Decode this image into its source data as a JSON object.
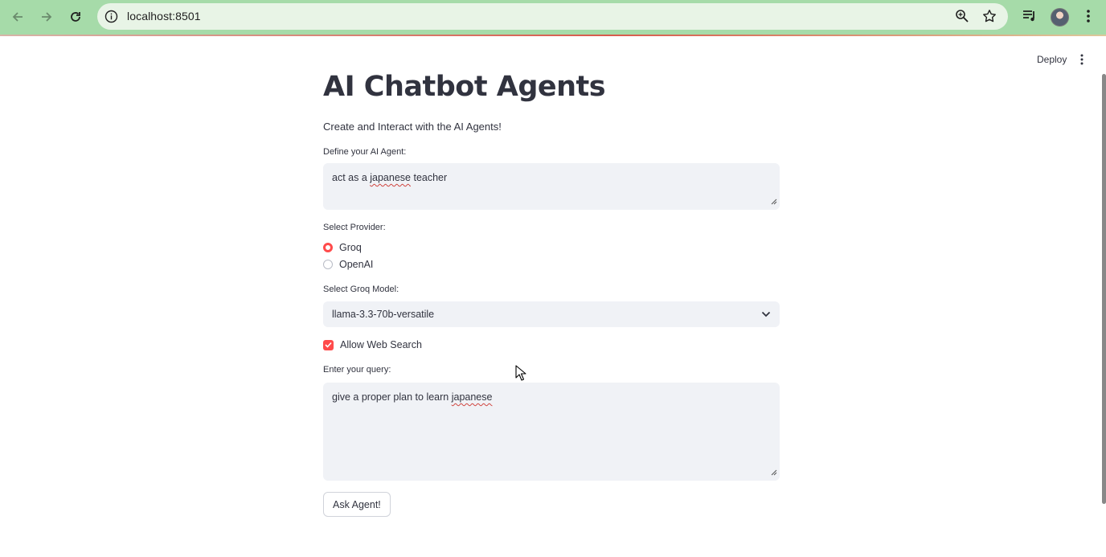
{
  "browser": {
    "url": "localhost:8501",
    "icons": [
      "back-arrow-icon",
      "forward-arrow-icon",
      "reload-icon",
      "info-icon",
      "zoom-icon",
      "star-icon",
      "media-control-icon",
      "profile-avatar",
      "more-vert-icon"
    ]
  },
  "toolbar": {
    "deploy_label": "Deploy"
  },
  "app": {
    "title": "AI Chatbot Agents",
    "subtitle": "Create and Interact with the AI Agents!",
    "agent": {
      "label": "Define your AI Agent:",
      "value_parts": [
        "act as a ",
        "japanese",
        " teacher"
      ]
    },
    "provider": {
      "label": "Select Provider:",
      "options": [
        "Groq",
        "OpenAI"
      ],
      "selected": "Groq"
    },
    "model": {
      "label": "Select Groq Model:",
      "value": "llama-3.3-70b-versatile"
    },
    "web_search": {
      "label": "Allow Web Search",
      "checked": true
    },
    "query": {
      "label": "Enter your query:",
      "value_parts": [
        "give a proper plan to learn ",
        "japanese"
      ]
    },
    "submit_label": "Ask Agent!"
  },
  "colors": {
    "accent": "#ff4b4b",
    "input_bg": "#f0f2f6",
    "text": "#31333f",
    "chrome_bg": "#a6dba9"
  }
}
